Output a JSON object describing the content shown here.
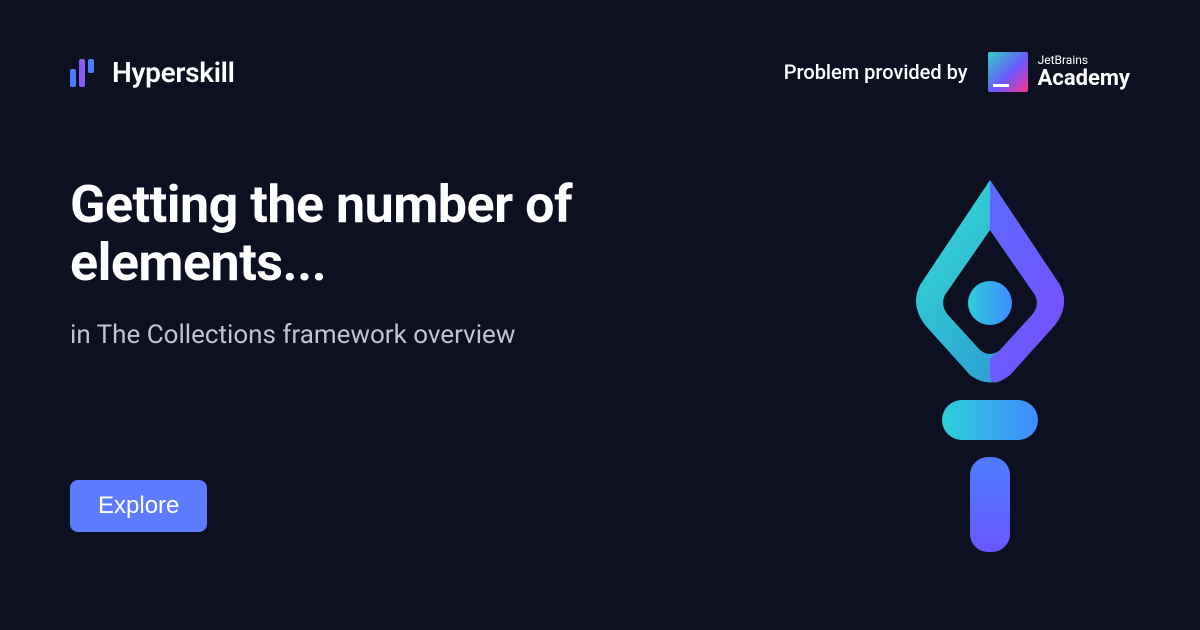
{
  "header": {
    "brand": "Hyperskill",
    "provided_by": "Problem provided by",
    "jetbrains_small": "JetBrains",
    "jetbrains_big": "Academy"
  },
  "main": {
    "title": "Getting the number of elements...",
    "subtitle": "in The Collections framework overview",
    "button": "Explore"
  }
}
